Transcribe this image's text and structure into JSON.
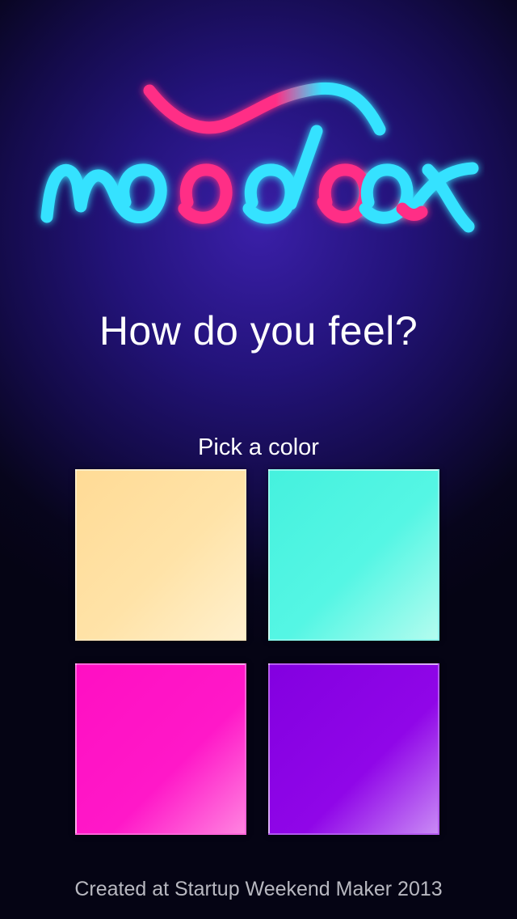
{
  "logo": {
    "name": "moodbox"
  },
  "headline": "How do you feel?",
  "subhead": "Pick a color",
  "swatches": [
    {
      "id": "yellow",
      "color": "#ffdf9e"
    },
    {
      "id": "aqua",
      "color": "#4ef5e2"
    },
    {
      "id": "pink",
      "color": "#ff16c8"
    },
    {
      "id": "purple",
      "color": "#8e00e6"
    }
  ],
  "footer": "Created at Startup Weekend Maker 2013",
  "colors": {
    "neon_cyan": "#35e2ff",
    "neon_pink": "#ff2f86"
  }
}
